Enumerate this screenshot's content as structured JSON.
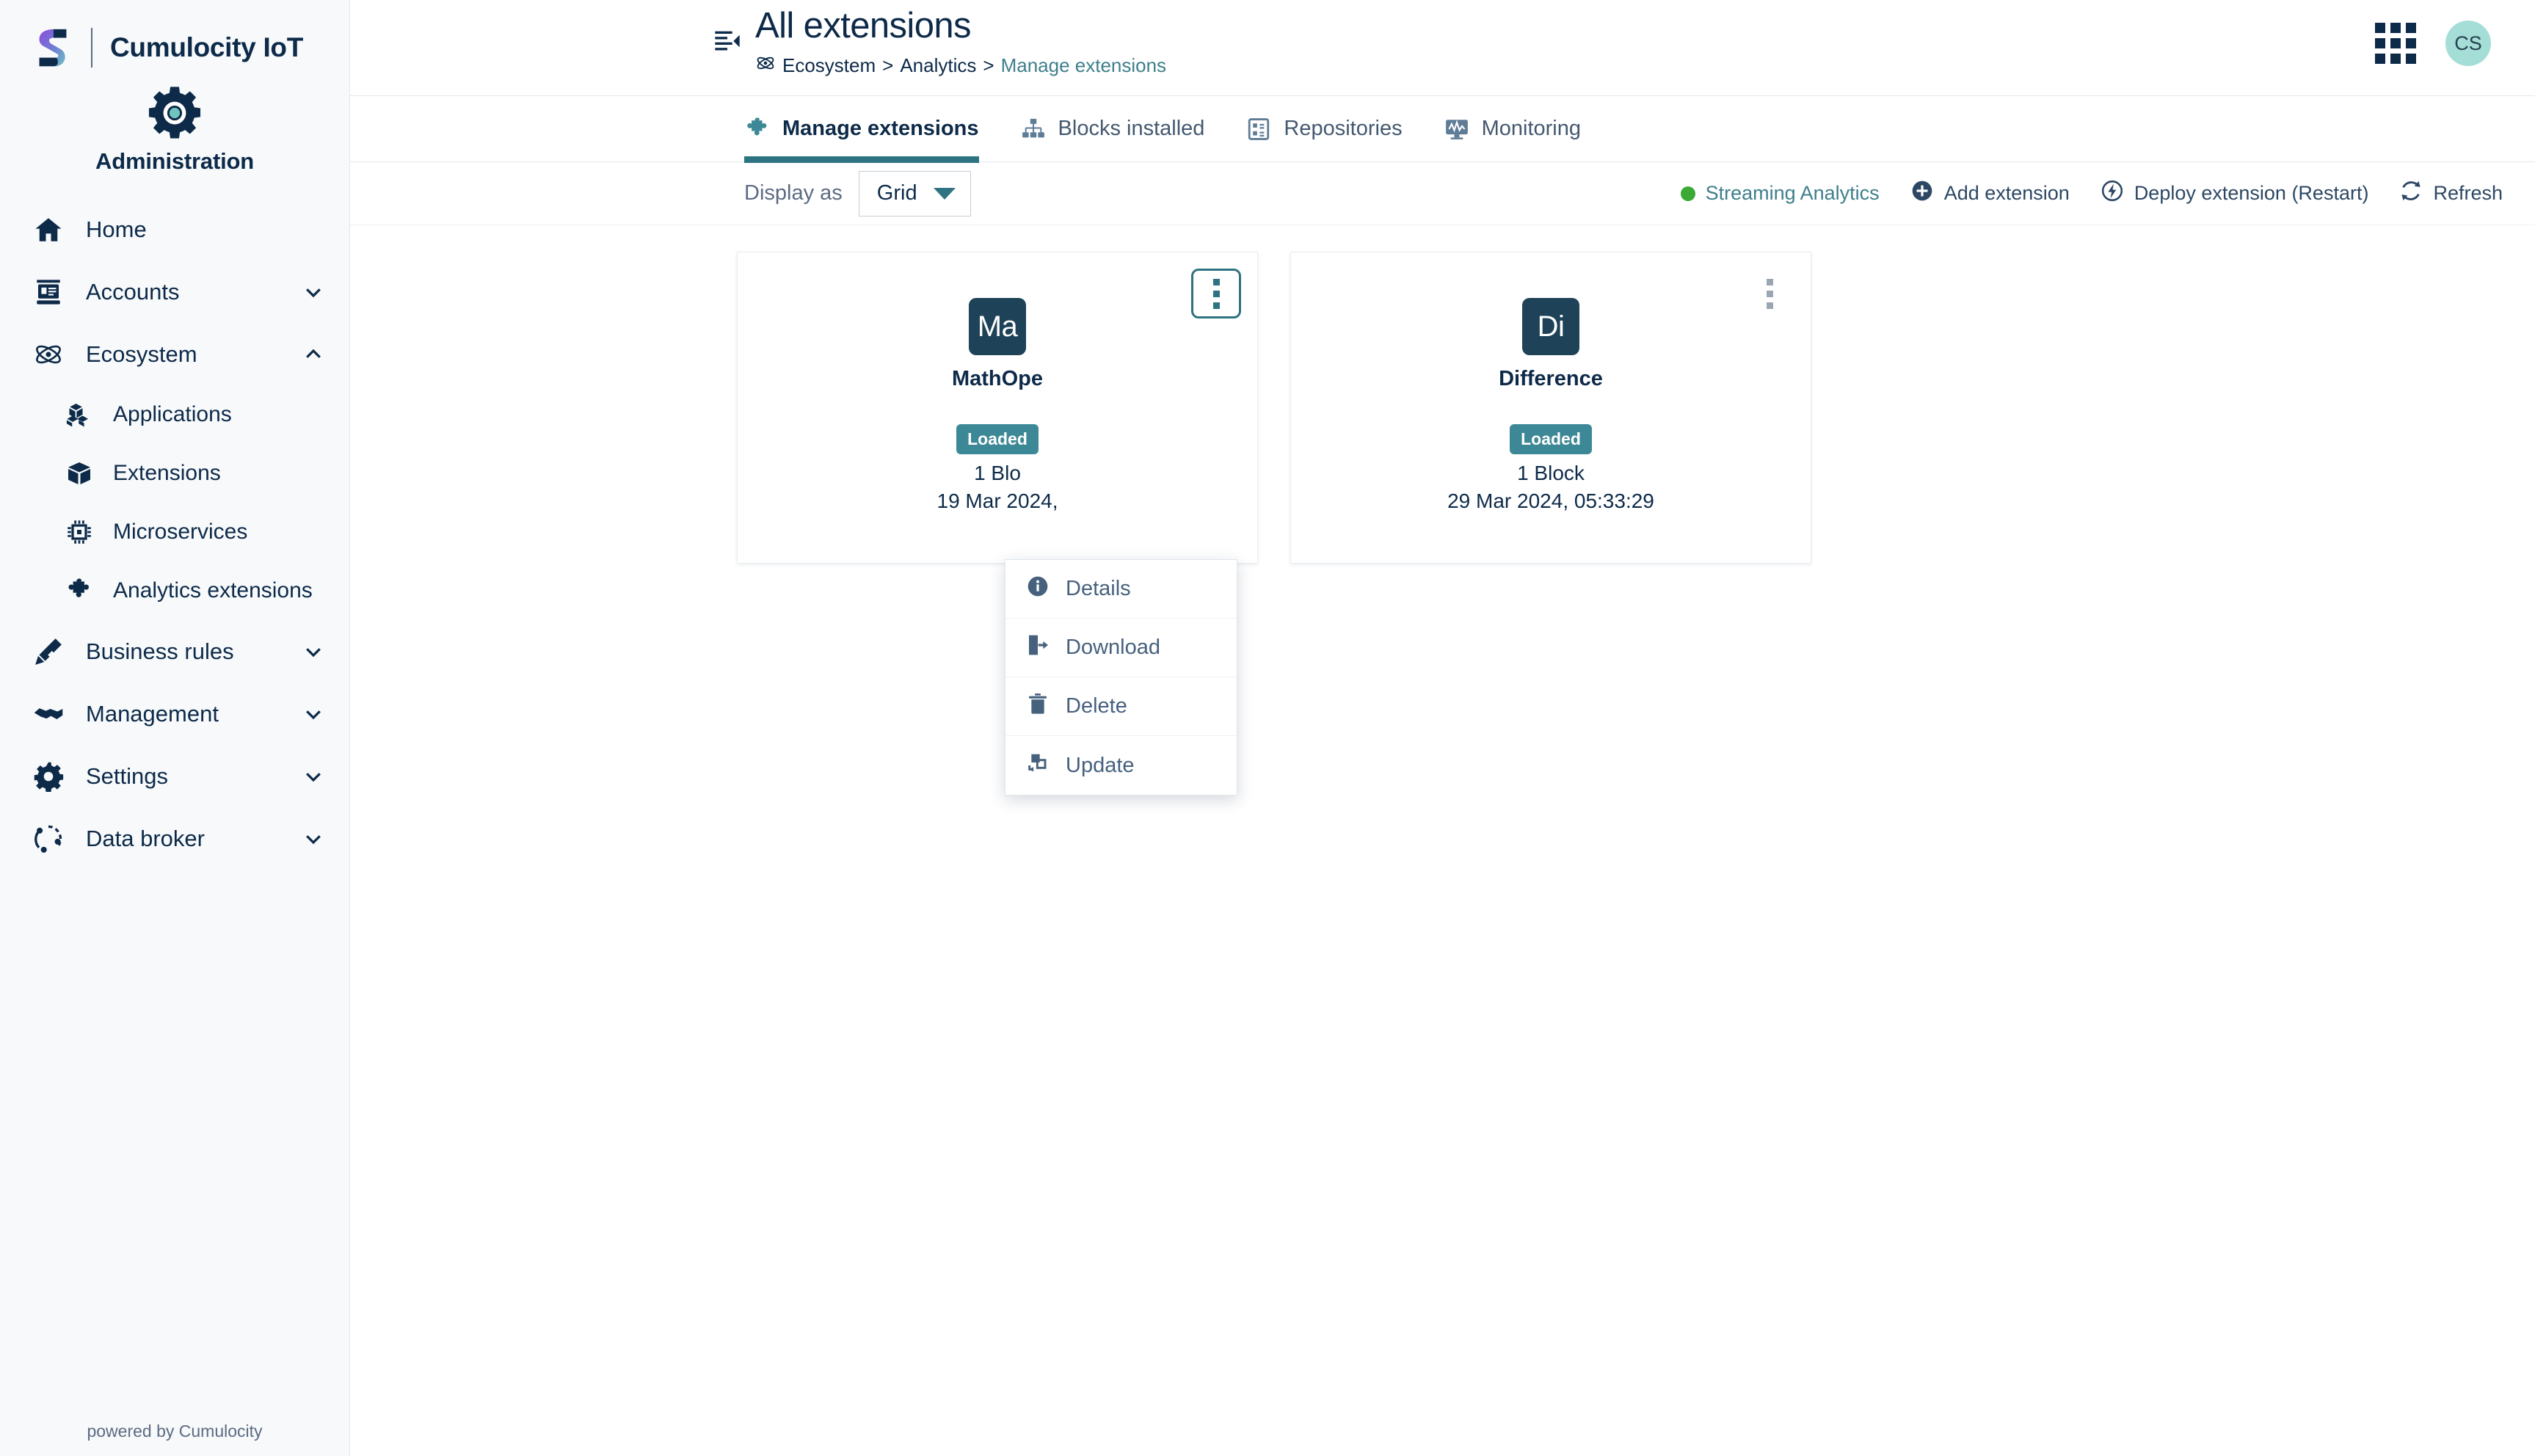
{
  "brand": {
    "name": "Cumulocity IoT",
    "logo_icon": "cumulocity-s-logo",
    "app_icon": "gear-icon",
    "app_label": "Administration"
  },
  "sidebar": {
    "items": [
      {
        "label": "Home",
        "icon": "home-icon",
        "expandable": false
      },
      {
        "label": "Accounts",
        "icon": "accounts-icon",
        "expandable": true,
        "expanded": false
      },
      {
        "label": "Ecosystem",
        "icon": "atom-icon",
        "expandable": true,
        "expanded": true
      },
      {
        "label": "Business rules",
        "icon": "pencil-ruler-icon",
        "expandable": true,
        "expanded": false
      },
      {
        "label": "Management",
        "icon": "handshake-icon",
        "expandable": true,
        "expanded": false
      },
      {
        "label": "Settings",
        "icon": "gear-icon",
        "expandable": true,
        "expanded": false
      },
      {
        "label": "Data broker",
        "icon": "data-broker-icon",
        "expandable": true,
        "expanded": false
      }
    ],
    "ecosystem_children": [
      {
        "label": "Applications",
        "icon": "cubes-icon"
      },
      {
        "label": "Extensions",
        "icon": "box-icon"
      },
      {
        "label": "Microservices",
        "icon": "chip-icon"
      },
      {
        "label": "Analytics extensions",
        "icon": "puzzle-icon"
      }
    ],
    "footer": "powered by Cumulocity"
  },
  "header": {
    "collapse_icon": "collapse-sidebar-icon",
    "title": "All extensions",
    "breadcrumb_icon": "atom-icon",
    "breadcrumb": [
      {
        "label": "Ecosystem",
        "active": false
      },
      {
        "label": "Analytics",
        "active": false
      },
      {
        "label": "Manage extensions",
        "active": true
      }
    ],
    "breadcrumb_separator": ">",
    "app_switcher_icon": "grid-apps-icon",
    "avatar_initials": "CS"
  },
  "tabs": [
    {
      "label": "Manage extensions",
      "icon": "puzzle-icon",
      "active": true
    },
    {
      "label": "Blocks installed",
      "icon": "blocks-hierarchy-icon",
      "active": false
    },
    {
      "label": "Repositories",
      "icon": "repository-icon",
      "active": false
    },
    {
      "label": "Monitoring",
      "icon": "monitoring-icon",
      "active": false
    }
  ],
  "toolbar": {
    "display_as_label": "Display as",
    "display_as_value": "Grid",
    "display_as_caret_icon": "chevron-down-icon",
    "actions": [
      {
        "label": "Streaming Analytics",
        "icon": "status-dot-icon",
        "style": "teal"
      },
      {
        "label": "Add extension",
        "icon": "plus-circle-icon",
        "style": "default"
      },
      {
        "label": "Deploy extension (Restart)",
        "icon": "deploy-icon",
        "style": "default"
      },
      {
        "label": "Refresh",
        "icon": "refresh-icon",
        "style": "default"
      }
    ]
  },
  "cards": [
    {
      "initials": "Ma",
      "name": "MathOpe",
      "badge": "Loaded",
      "blocks": "1 Blo",
      "date": "19 Mar 2024,",
      "menu_open": true
    },
    {
      "initials": "Di",
      "name": "Difference",
      "badge": "Loaded",
      "blocks": "1 Block",
      "date": "29 Mar 2024, 05:33:29",
      "menu_open": false
    }
  ],
  "context_menu": {
    "items": [
      {
        "label": "Details",
        "icon": "info-circle-icon"
      },
      {
        "label": "Download",
        "icon": "download-icon"
      },
      {
        "label": "Delete",
        "icon": "trash-icon"
      },
      {
        "label": "Update",
        "icon": "update-icon"
      }
    ]
  },
  "colors": {
    "brand_dark": "#0d2a49",
    "accent_teal": "#2e7382",
    "badge_teal": "#3d8896",
    "status_green": "#3aaa35",
    "avatar_bg": "#a5ddd7",
    "sidebar_bg": "#f7f9fb"
  }
}
